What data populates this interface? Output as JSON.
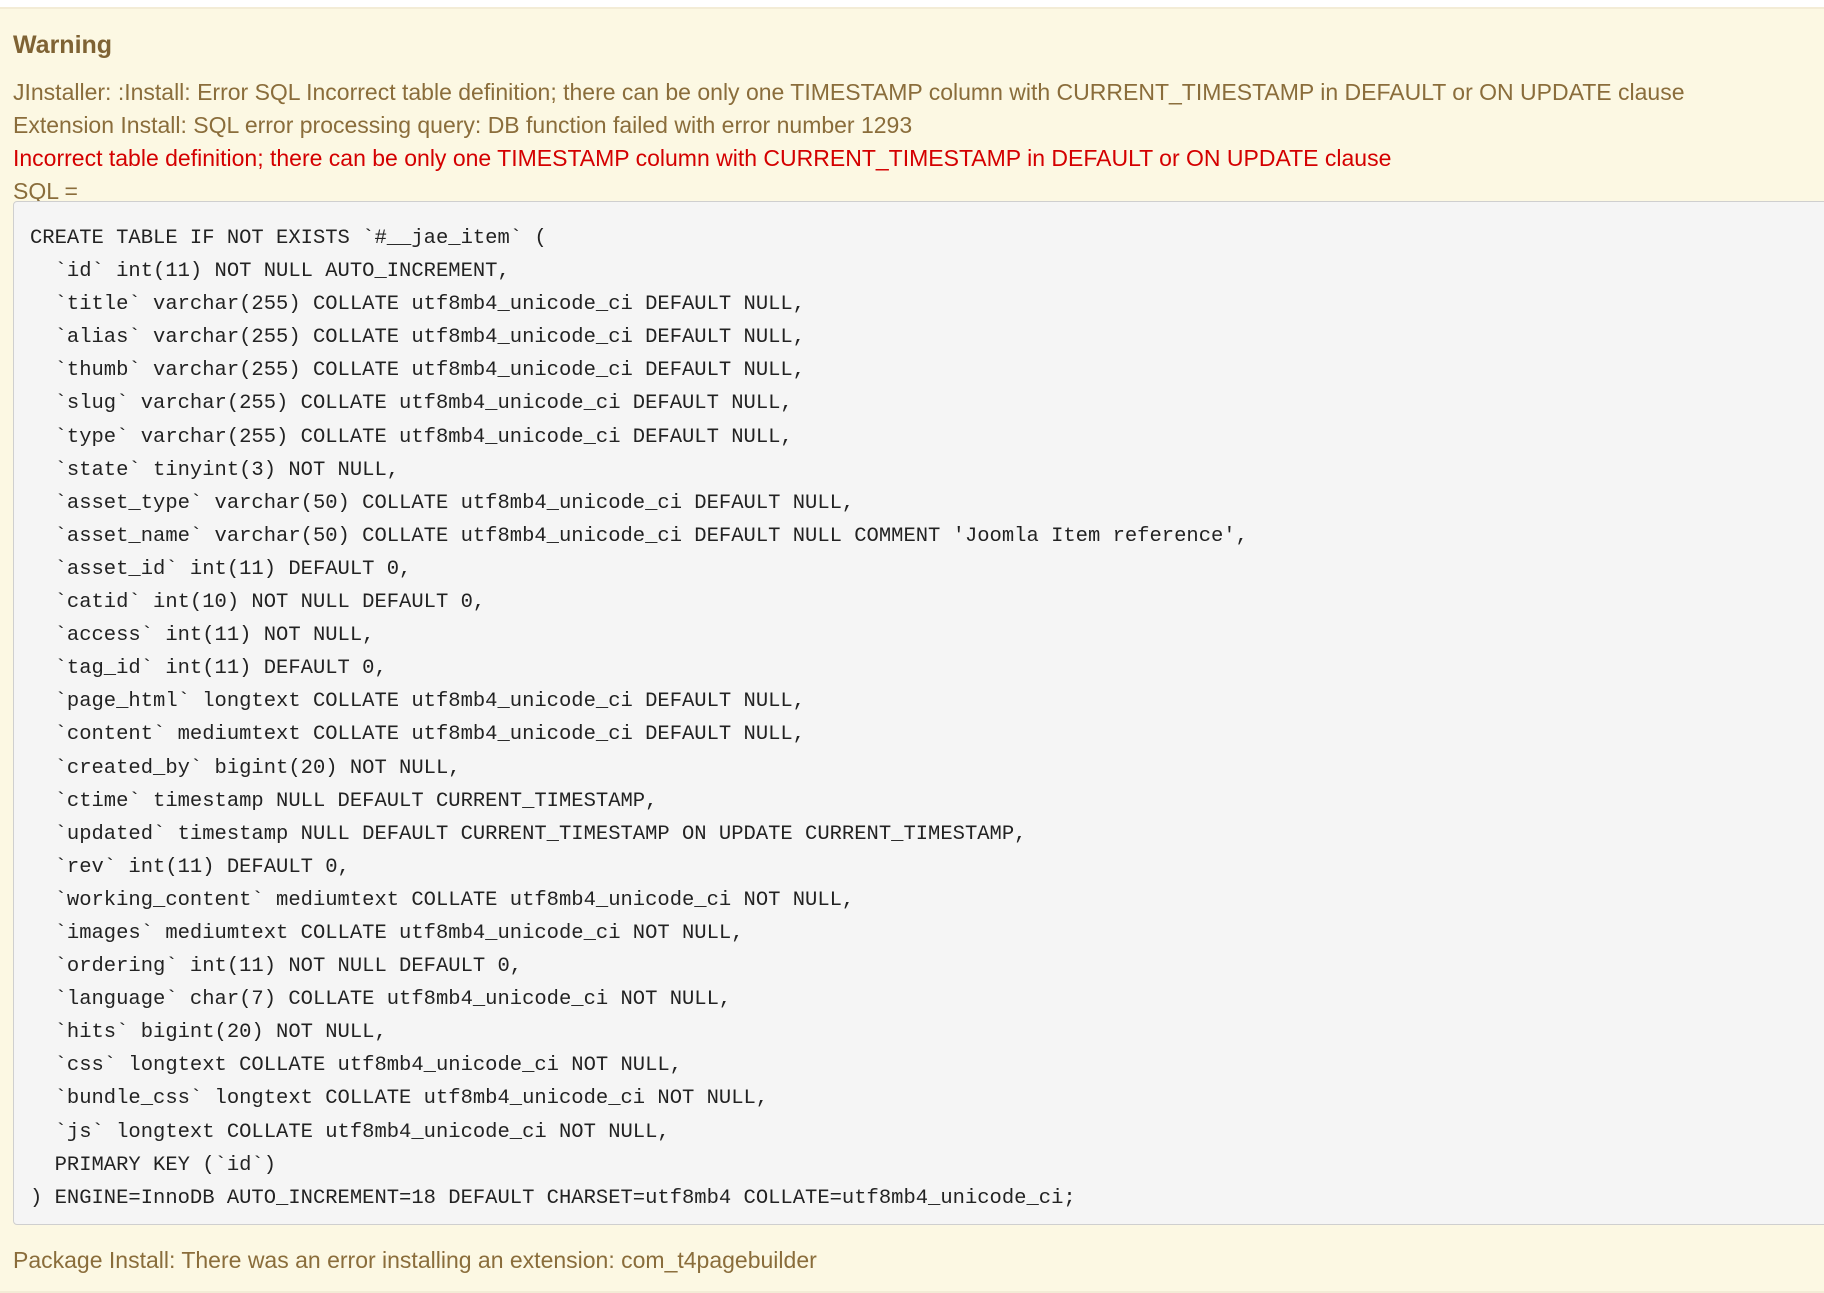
{
  "alert": {
    "heading": "Warning",
    "messages": [
      "JInstaller: :Install: Error SQL Incorrect table definition; there can be only one TIMESTAMP column with CURRENT_TIMESTAMP in DEFAULT or ON UPDATE clause",
      "Extension Install: SQL error processing query: DB function failed with error number 1293"
    ],
    "error": "Incorrect table definition; there can be only one TIMESTAMP column with CURRENT_TIMESTAMP in DEFAULT or ON UPDATE clause",
    "sql_label": "SQL =",
    "sql": "CREATE TABLE IF NOT EXISTS `#__jae_item` (\n  `id` int(11) NOT NULL AUTO_INCREMENT,\n  `title` varchar(255) COLLATE utf8mb4_unicode_ci DEFAULT NULL,\n  `alias` varchar(255) COLLATE utf8mb4_unicode_ci DEFAULT NULL,\n  `thumb` varchar(255) COLLATE utf8mb4_unicode_ci DEFAULT NULL,\n  `slug` varchar(255) COLLATE utf8mb4_unicode_ci DEFAULT NULL,\n  `type` varchar(255) COLLATE utf8mb4_unicode_ci DEFAULT NULL,\n  `state` tinyint(3) NOT NULL,\n  `asset_type` varchar(50) COLLATE utf8mb4_unicode_ci DEFAULT NULL,\n  `asset_name` varchar(50) COLLATE utf8mb4_unicode_ci DEFAULT NULL COMMENT 'Joomla Item reference',\n  `asset_id` int(11) DEFAULT 0,\n  `catid` int(10) NOT NULL DEFAULT 0,\n  `access` int(11) NOT NULL,\n  `tag_id` int(11) DEFAULT 0,\n  `page_html` longtext COLLATE utf8mb4_unicode_ci DEFAULT NULL,\n  `content` mediumtext COLLATE utf8mb4_unicode_ci DEFAULT NULL,\n  `created_by` bigint(20) NOT NULL,\n  `ctime` timestamp NULL DEFAULT CURRENT_TIMESTAMP,\n  `updated` timestamp NULL DEFAULT CURRENT_TIMESTAMP ON UPDATE CURRENT_TIMESTAMP,\n  `rev` int(11) DEFAULT 0,\n  `working_content` mediumtext COLLATE utf8mb4_unicode_ci NOT NULL,\n  `images` mediumtext COLLATE utf8mb4_unicode_ci NOT NULL,\n  `ordering` int(11) NOT NULL DEFAULT 0,\n  `language` char(7) COLLATE utf8mb4_unicode_ci NOT NULL,\n  `hits` bigint(20) NOT NULL,\n  `css` longtext COLLATE utf8mb4_unicode_ci NOT NULL,\n  `bundle_css` longtext COLLATE utf8mb4_unicode_ci NOT NULL,\n  `js` longtext COLLATE utf8mb4_unicode_ci NOT NULL,\n  PRIMARY KEY (`id`)\n) ENGINE=InnoDB AUTO_INCREMENT=18 DEFAULT CHARSET=utf8mb4 COLLATE=utf8mb4_unicode_ci;",
    "package_message": "Package Install: There was an error installing an extension: com_t4pagebuilder"
  }
}
